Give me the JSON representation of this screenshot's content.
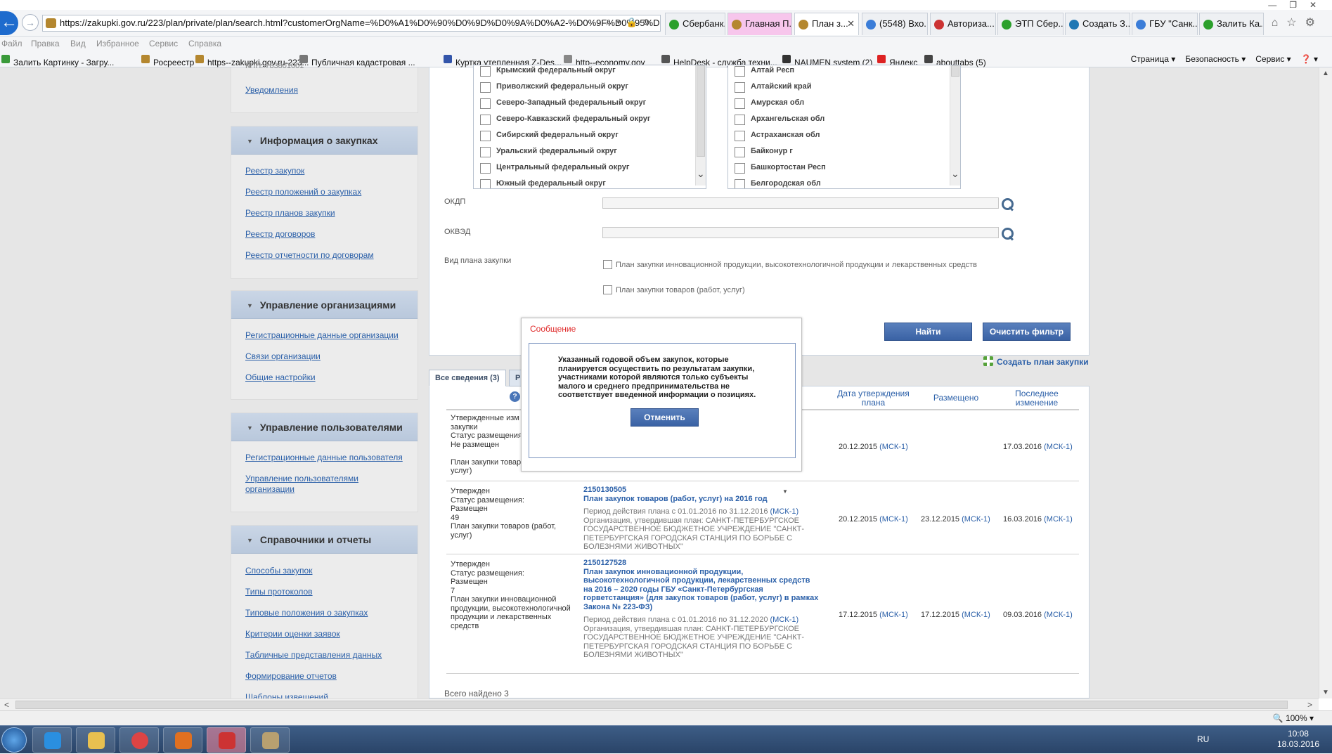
{
  "browser": {
    "url": "https://zakupki.gov.ru/223/plan/private/plan/search.html?customerOrgName=%D0%A1%D0%90%D0%9D%D0%9A%D0%A2-%D0%9F%D0%95%D0",
    "tabs": [
      {
        "label": "Сбербанк...",
        "color": "#2ca02c"
      },
      {
        "label": "Главная П...",
        "color": "#b4872f"
      },
      {
        "label": "План з...",
        "color": "#b4872f"
      },
      {
        "label": "(5548) Вхо...",
        "color": "#3b7dd8"
      },
      {
        "label": "Авториза...",
        "color": "#cc3333"
      },
      {
        "label": "ЭТП Сбер...",
        "color": "#2ca02c"
      },
      {
        "label": "Создать З...",
        "color": "#1f77b4"
      },
      {
        "label": "ГБУ \"Санк...",
        "color": "#3b7dd8"
      },
      {
        "label": "Залить Ка...",
        "color": "#2ca02c"
      }
    ],
    "menu": [
      "Файл",
      "Правка",
      "Вид",
      "Избранное",
      "Сервис",
      "Справка"
    ],
    "favorites": [
      {
        "label": "Залить Картинку - Загру...",
        "color": "#3a9a3a"
      },
      {
        "label": "Росреестр",
        "color": "#b4872f"
      },
      {
        "label": "https--zakupki.gov.ru-223...",
        "color": "#b4872f"
      },
      {
        "label": "Публичная кадастровая ...",
        "color": "#777777"
      },
      {
        "label": "Куртка утепленная Z-Des...",
        "color": "#3355aa"
      },
      {
        "label": "http--economy.gov",
        "color": "#888888"
      },
      {
        "label": "HelpDesk - служба техни...",
        "color": "#555555"
      },
      {
        "label": "NAUMEN system (2)",
        "color": "#333333"
      },
      {
        "label": "Яндекс",
        "color": "#dd2222"
      },
      {
        "label": "abouttabs (5)",
        "color": "#444444"
      }
    ],
    "commands": [
      "Страница ▾",
      "Безопасность ▾",
      "Сервис ▾",
      "❓ ▾"
    ],
    "zoom": "100%"
  },
  "sidebar": {
    "top_link": "Уведомления",
    "sections": [
      {
        "title": "Информация о закупках",
        "links": [
          "Реестр закупок",
          "Реестр положений о закупках",
          "Реестр планов закупки",
          "Реестр договоров",
          "Реестр отчетности по договорам"
        ]
      },
      {
        "title": "Управление организациями",
        "links": [
          "Регистрационные данные организации",
          "Связи организации",
          "Общие настройки"
        ]
      },
      {
        "title": "Управление пользователями",
        "links": [
          "Регистрационные данные пользователя",
          "Управление пользователями организации"
        ]
      },
      {
        "title": "Справочники и отчеты",
        "links": [
          "Способы закупок",
          "Типы протоколов",
          "Типовые положения о закупках",
          "Критерии оценки заявок",
          "Табличные представления данных",
          "Формирование отчетов",
          "Шаблоны извещений"
        ]
      }
    ]
  },
  "filter": {
    "districts": [
      "Крымский федеральный округ",
      "Приволжский федеральный округ",
      "Северо-Западный федеральный округ",
      "Северо-Кавказский федеральный округ",
      "Сибирский федеральный округ",
      "Уральский федеральный округ",
      "Центральный федеральный округ",
      "Южный федеральный округ"
    ],
    "regions": [
      "Алтай Респ",
      "Алтайский край",
      "Амурская обл",
      "Архангельская обл",
      "Астраханская обл",
      "Байконур г",
      "Башкортостан Респ",
      "Белгородская обл"
    ],
    "okdp_label": "ОКДП",
    "okved_label": "ОКВЭД",
    "plan_type_label": "Вид плана закупки",
    "plan_type_options": [
      "План закупки инновационной продукции, высокотехнологичной продукции и лекарственных средств",
      "План закупки товаров (работ, услуг)"
    ],
    "find_button": "Найти",
    "clear_button": "Очистить фильтр",
    "create_link": "Создать план закупки"
  },
  "results": {
    "tabs": [
      "Все сведения (3)",
      "Р"
    ],
    "columns": {
      "approved": "Дата утверждения плана",
      "placed": "Размещено",
      "changed": "Последнее изменение"
    },
    "rows": [
      {
        "status": [
          "Утвержденные изм",
          "закупки",
          "Статус размещения",
          "Не размещен",
          "",
          "План закупки товар",
          "услуг)"
        ],
        "number": "",
        "title": "",
        "period": "",
        "period_link": "",
        "org": "",
        "approved_date": "20.12.2015",
        "approved_tz": "(МСК-1)",
        "placed_date": "",
        "placed_tz": "",
        "changed_date": "17.03.2016",
        "changed_tz": "(МСК-1)"
      },
      {
        "status": [
          "Утвержден",
          "Статус размещения:",
          "Размещен",
          "49",
          "План закупки товаров (работ,",
          "услуг)"
        ],
        "number": "2150130505",
        "title": "План закупок товаров (работ, услуг) на 2016 год",
        "period": "Период действия плана с 01.01.2016 по 31.12.2016",
        "period_link": "(МСК-1)",
        "org": "Организация, утвердившая план: САНКТ-ПЕТЕРБУРГСКОЕ ГОСУДАРСТВЕННОЕ БЮДЖЕТНОЕ УЧРЕЖДЕНИЕ \"САНКТ-ПЕТЕРБУРГСКАЯ ГОРОДСКАЯ СТАНЦИЯ ПО БОРЬБЕ С БОЛЕЗНЯМИ ЖИВОТНЫХ\"",
        "approved_date": "20.12.2015",
        "approved_tz": "(МСК-1)",
        "placed_date": "23.12.2015",
        "placed_tz": "(МСК-1)",
        "changed_date": "16.03.2016",
        "changed_tz": "(МСК-1)"
      },
      {
        "status": [
          "Утвержден",
          "Статус размещения:",
          "Размещен",
          "7",
          "План закупки инновационной",
          "продукции, высокотехнологичной",
          "продукции и лекарственных",
          "средств"
        ],
        "number": "2150127528",
        "title": "План закупок инновационной продукции, высокотехнологичной продукции, лекарственных средств на 2016 – 2020 годы ГБУ «Санкт-Петербургская горветстанция» (для закупок товаров (работ, услуг) в рамках Закона № 223-ФЗ)",
        "period": "Период действия плана с 01.01.2016 по 31.12.2020",
        "period_link": "(МСК-1)",
        "org": "Организация, утвердившая план: САНКТ-ПЕТЕРБУРГСКОЕ ГОСУДАРСТВЕННОЕ БЮДЖЕТНОЕ УЧРЕЖДЕНИЕ \"САНКТ-ПЕТЕРБУРГСКАЯ ГОРОДСКАЯ СТАНЦИЯ ПО БОРЬБЕ С БОЛЕЗНЯМИ ЖИВОТНЫХ\"",
        "approved_date": "17.12.2015",
        "approved_tz": "(МСК-1)",
        "placed_date": "17.12.2015",
        "placed_tz": "(МСК-1)",
        "changed_date": "09.03.2016",
        "changed_tz": "(МСК-1)"
      }
    ],
    "total": "Всего найдено 3"
  },
  "modal": {
    "title": "Сообщение",
    "text": "Указанный годовой объем закупок, которые планируется осуществить по результатам закупки, участниками которой являются только субъекты малого и среднего предпринимательства не соответствует введенной информации о позициях.",
    "cancel_button": "Отменить"
  },
  "taskbar": {
    "lang": "RU",
    "time": "10:08",
    "date": "18.03.2016"
  }
}
